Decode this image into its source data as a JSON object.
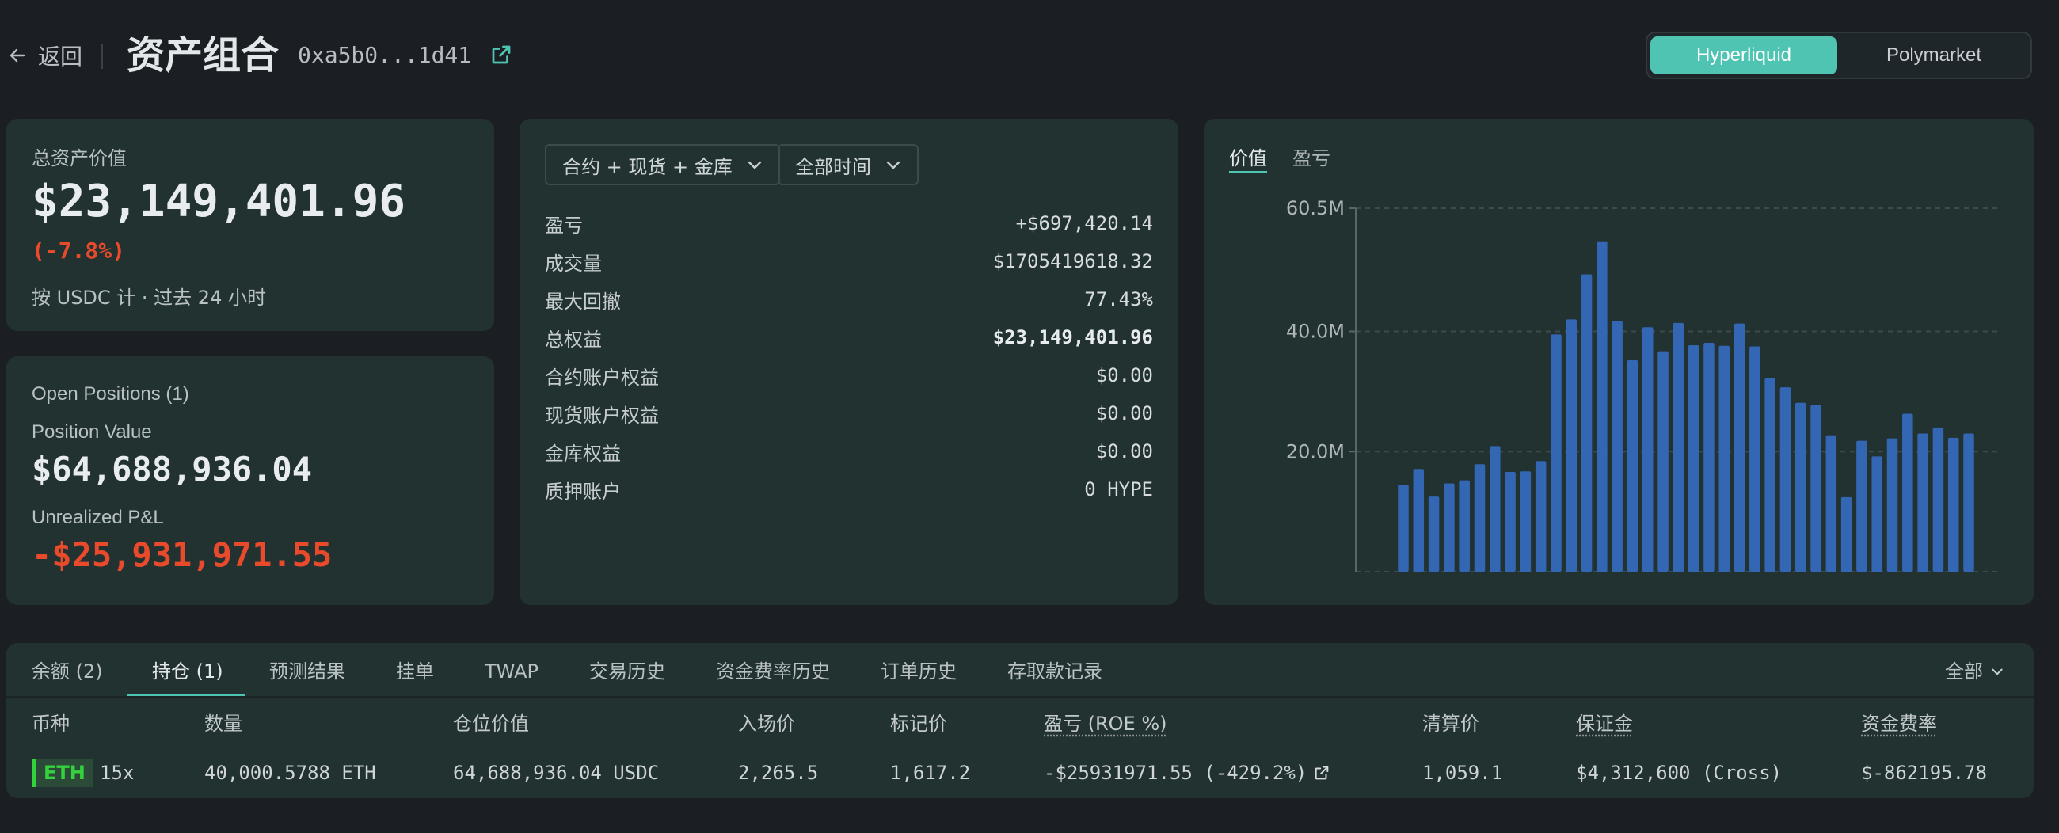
{
  "header": {
    "back_label": "返回",
    "title": "资产组合",
    "address": "0xa5b0...1d41",
    "platforms": [
      "Hyperliquid",
      "Polymarket"
    ]
  },
  "summary": {
    "label": "总资产价值",
    "value": "$23,149,401.96",
    "change": "(-7.8%)",
    "note": "按 USDC 计 · 过去 24 小时"
  },
  "positions_card": {
    "title": "Open Positions (1)",
    "position_value_label": "Position Value",
    "position_value": "$64,688,936.04",
    "upnl_label": "Unrealized P&L",
    "upnl": "-$25,931,971.55"
  },
  "stats": {
    "filter_scope": "合约 + 现货 + 金库",
    "filter_time": "全部时间",
    "rows": [
      {
        "k": "盈亏",
        "v": "+$697,420.14"
      },
      {
        "k": "成交量",
        "v": "$1705419618.32"
      },
      {
        "k": "最大回撤",
        "v": "77.43%"
      },
      {
        "k": "总权益",
        "v": "$23,149,401.96"
      },
      {
        "k": "合约账户权益",
        "v": "$0.00"
      },
      {
        "k": "现货账户权益",
        "v": "$0.00"
      },
      {
        "k": "金库权益",
        "v": "$0.00"
      },
      {
        "k": "质押账户",
        "v": "0 HYPE"
      }
    ]
  },
  "chart_panel": {
    "tabs": [
      "价值",
      "盈亏"
    ]
  },
  "chart_data": {
    "type": "bar",
    "yticks": [
      "60.5M",
      "40.0M",
      "20.0M"
    ],
    "ytick_values": [
      60.5,
      40.0,
      20.0
    ],
    "ylim": [
      0,
      60.5
    ],
    "grid": true,
    "values": [
      14.5,
      17.1,
      12.5,
      14.7,
      15.2,
      17.9,
      20.9,
      16.6,
      16.7,
      18.4,
      39.5,
      42.0,
      49.5,
      55.0,
      41.7,
      35.2,
      40.7,
      36.7,
      41.4,
      37.7,
      38.1,
      37.6,
      41.3,
      37.5,
      32.2,
      30.7,
      28.1,
      27.7,
      22.7,
      12.4,
      21.8,
      19.2,
      22.2,
      26.3,
      23.0,
      24.0,
      22.3,
      23.0
    ],
    "bar_color": "#3367b4"
  },
  "bottom": {
    "tabs": [
      "余额 (2)",
      "持仓 (1)",
      "预测结果",
      "挂单",
      "TWAP",
      "交易历史",
      "资金费率历史",
      "订单历史",
      "存取款记录"
    ],
    "filter": "全部",
    "columns": [
      "币种",
      "数量",
      "仓位价值",
      "入场价",
      "标记价",
      "盈亏 (ROE %)",
      "清算价",
      "保证金",
      "资金费率"
    ],
    "row": {
      "coin": "ETH",
      "leverage": "15x",
      "size": "40,000.5788 ETH",
      "position_value": "64,688,936.04 USDC",
      "entry": "2,265.5",
      "mark": "1,617.2",
      "pnl": "-$25931971.55 (-429.2%)",
      "liq": "1,059.1",
      "margin": "$4,312,600 (Cross)",
      "funding": "$-862195.78"
    }
  },
  "colors": {
    "accent": "#4fc4b2",
    "positive": "#34d23c",
    "negative": "#ea4a2c"
  }
}
